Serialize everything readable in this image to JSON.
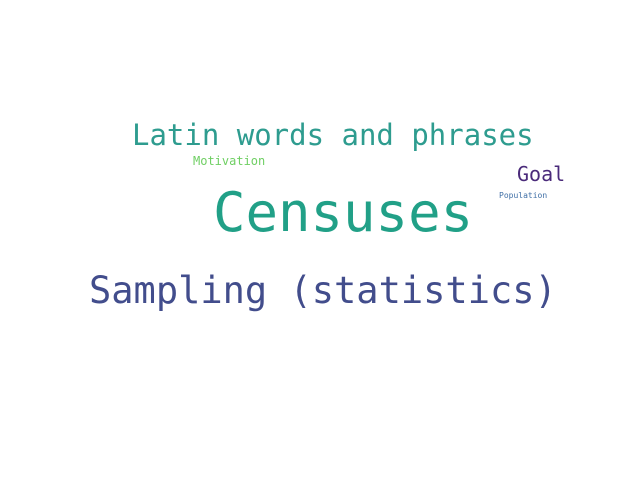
{
  "words": [
    {
      "text": "Latin words and phrases",
      "color": "#2e9c8f"
    },
    {
      "text": "Motivation",
      "color": "#6fcf63"
    },
    {
      "text": "Goal",
      "color": "#4a2a7a"
    },
    {
      "text": "Population",
      "color": "#3f6fa6"
    },
    {
      "text": "Censuses",
      "color": "#21a087"
    },
    {
      "text": "Sampling (statistics)",
      "color": "#424d8c"
    }
  ]
}
